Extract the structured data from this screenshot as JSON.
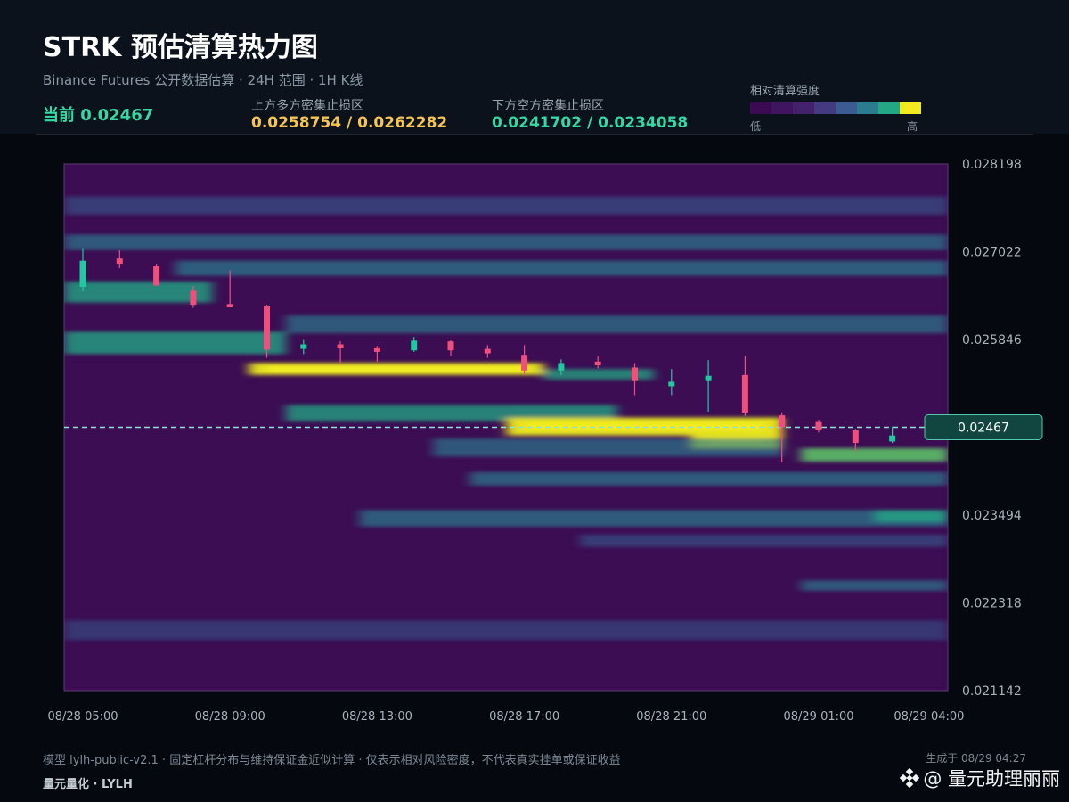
{
  "header": {
    "title": "STRK 预估清算热力图",
    "subtitle": "Binance Futures 公开数据估算 · 24H 范围 · 1H K线",
    "current_label": "当前 0.02467",
    "upper_zone_label": "上方多方密集止损区",
    "upper_zone_value": "0.0258754 / 0.0262282",
    "lower_zone_label": "下方空方密集止损区",
    "lower_zone_value": "0.0241702 / 0.0234058",
    "legend_title": "相对清算强度",
    "legend_low": "低",
    "legend_high": "高",
    "legend_colors": [
      "#3b0a52",
      "#3f1560",
      "#43226b",
      "#443a82",
      "#3b5b92",
      "#2a7c8e",
      "#22a884",
      "#f0ea1e"
    ]
  },
  "footer": {
    "note": "模型 lylh-public-v2.1 · 固定杠杆分布与维持保证金近似计算 · 仅表示相对风险密度，不代表真实挂单或保证收益",
    "generated": "生成于 08/29 04:27",
    "brand": "量元量化 · LYLH",
    "watermark": "@ 量元助理丽丽"
  },
  "colors": {
    "up": "#22c8a0",
    "down": "#ef4f7c",
    "current_line": "#8fe0d8",
    "current_tag_bg": "#10463f",
    "current_tag_border": "#52c8b0"
  },
  "chart_data": {
    "type": "heatmap",
    "subtype": "candlestick-overlay",
    "x_tick_labels": [
      "08/28 05:00",
      "08/28 09:00",
      "08/28 13:00",
      "08/28 17:00",
      "08/28 21:00",
      "08/29 01:00",
      "08/29 04:00"
    ],
    "x_tick_hours": [
      0,
      4,
      8,
      12,
      16,
      20,
      23
    ],
    "y_tick_labels": [
      "0.028198",
      "0.027022",
      "0.025846",
      "0.024670",
      "0.023494",
      "0.022318",
      "0.021142"
    ],
    "ylim": [
      0.021142,
      0.028198
    ],
    "current_price": 0.02467,
    "current_price_label": "0.02467",
    "candles": [
      {
        "h": 0,
        "o": 0.02655,
        "c": 0.0269,
        "hi": 0.02707,
        "lo": 0.0265
      },
      {
        "h": 1,
        "o": 0.02693,
        "c": 0.02686,
        "hi": 0.02704,
        "lo": 0.0268
      },
      {
        "h": 2,
        "o": 0.02683,
        "c": 0.02657,
        "hi": 0.02686,
        "lo": 0.02656
      },
      {
        "h": 3,
        "o": 0.02651,
        "c": 0.02631,
        "hi": 0.02656,
        "lo": 0.02627
      },
      {
        "h": 4,
        "o": 0.02632,
        "c": 0.0263,
        "hi": 0.02677,
        "lo": 0.02628
      },
      {
        "h": 5,
        "o": 0.0263,
        "c": 0.02571,
        "hi": 0.02631,
        "lo": 0.0256
      },
      {
        "h": 6,
        "o": 0.02572,
        "c": 0.02578,
        "hi": 0.02585,
        "lo": 0.02565
      },
      {
        "h": 7,
        "o": 0.02578,
        "c": 0.02573,
        "hi": 0.02582,
        "lo": 0.02553
      },
      {
        "h": 8,
        "o": 0.02574,
        "c": 0.02568,
        "hi": 0.02576,
        "lo": 0.02555
      },
      {
        "h": 9,
        "o": 0.0257,
        "c": 0.02583,
        "hi": 0.02588,
        "lo": 0.02568
      },
      {
        "h": 10,
        "o": 0.02582,
        "c": 0.0257,
        "hi": 0.02584,
        "lo": 0.02562
      },
      {
        "h": 11,
        "o": 0.02572,
        "c": 0.02566,
        "hi": 0.02577,
        "lo": 0.0256
      },
      {
        "h": 12,
        "o": 0.02564,
        "c": 0.02543,
        "hi": 0.02577,
        "lo": 0.02538
      },
      {
        "h": 13,
        "o": 0.02543,
        "c": 0.02553,
        "hi": 0.02558,
        "lo": 0.02537
      },
      {
        "h": 14,
        "o": 0.02555,
        "c": 0.0255,
        "hi": 0.02562,
        "lo": 0.02546
      },
      {
        "h": 15,
        "o": 0.02547,
        "c": 0.0253,
        "hi": 0.02553,
        "lo": 0.0251
      },
      {
        "h": 16,
        "o": 0.02522,
        "c": 0.02528,
        "hi": 0.02545,
        "lo": 0.0251
      },
      {
        "h": 17,
        "o": 0.0253,
        "c": 0.02536,
        "hi": 0.02557,
        "lo": 0.02488
      },
      {
        "h": 18,
        "o": 0.02537,
        "c": 0.02486,
        "hi": 0.02562,
        "lo": 0.02482
      },
      {
        "h": 19,
        "o": 0.02483,
        "c": 0.02467,
        "hi": 0.02487,
        "lo": 0.0242
      },
      {
        "h": 20,
        "o": 0.02474,
        "c": 0.02464,
        "hi": 0.02477,
        "lo": 0.0246
      },
      {
        "h": 21,
        "o": 0.02463,
        "c": 0.02446,
        "hi": 0.02465,
        "lo": 0.02435
      },
      {
        "h": 22,
        "o": 0.02448,
        "c": 0.02456,
        "hi": 0.02468,
        "lo": 0.02446
      },
      {
        "h": 23,
        "o": 0.0246,
        "c": 0.02467,
        "hi": 0.0247,
        "lo": 0.02456
      }
    ],
    "bands": [
      {
        "p": 0.02764,
        "s": 0.00012,
        "a": 0.32,
        "h0": 0,
        "h1": 24
      },
      {
        "p": 0.02715,
        "s": 0.0001,
        "a": 0.38,
        "h0": 0,
        "h1": 24
      },
      {
        "p": 0.0268,
        "s": 0.0001,
        "a": 0.45,
        "h0": 3,
        "h1": 24
      },
      {
        "p": 0.02648,
        "s": 0.00014,
        "a": 0.55,
        "h0": 0,
        "h1": 4
      },
      {
        "p": 0.02605,
        "s": 0.00012,
        "a": 0.38,
        "h0": 6,
        "h1": 24
      },
      {
        "p": 0.0258,
        "s": 0.00015,
        "a": 0.55,
        "h0": 0,
        "h1": 6
      },
      {
        "p": 0.02545,
        "s": 8e-05,
        "a": 0.85,
        "h0": 5,
        "h1": 13
      },
      {
        "p": 0.02538,
        "s": 7e-05,
        "a": 0.48,
        "h0": 13,
        "h1": 16
      },
      {
        "p": 0.02486,
        "s": 0.00011,
        "a": 0.5,
        "h0": 6,
        "h1": 15
      },
      {
        "p": 0.02468,
        "s": 0.00012,
        "a": 0.88,
        "h0": 12,
        "h1": 19.5
      },
      {
        "p": 0.02448,
        "s": 0.0001,
        "a": 0.82,
        "h0": 17,
        "h1": 19.5
      },
      {
        "p": 0.0243,
        "s": 9e-05,
        "a": 0.62,
        "h0": 20,
        "h1": 24
      },
      {
        "p": 0.0244,
        "s": 0.00012,
        "a": 0.35,
        "h0": 10,
        "h1": 19.5
      },
      {
        "p": 0.02398,
        "s": 9e-05,
        "a": 0.4,
        "h0": 11,
        "h1": 24
      },
      {
        "p": 0.02345,
        "s": 0.00011,
        "a": 0.42,
        "h0": 8,
        "h1": 24
      },
      {
        "p": 0.02348,
        "s": 8e-05,
        "a": 0.55,
        "h0": 22,
        "h1": 24
      },
      {
        "p": 0.02315,
        "s": 8e-05,
        "a": 0.3,
        "h0": 14,
        "h1": 24
      },
      {
        "p": 0.02255,
        "s": 7e-05,
        "a": 0.35,
        "h0": 20,
        "h1": 24
      },
      {
        "p": 0.02195,
        "s": 0.00013,
        "a": 0.2,
        "h0": 0,
        "h1": 24
      }
    ]
  }
}
